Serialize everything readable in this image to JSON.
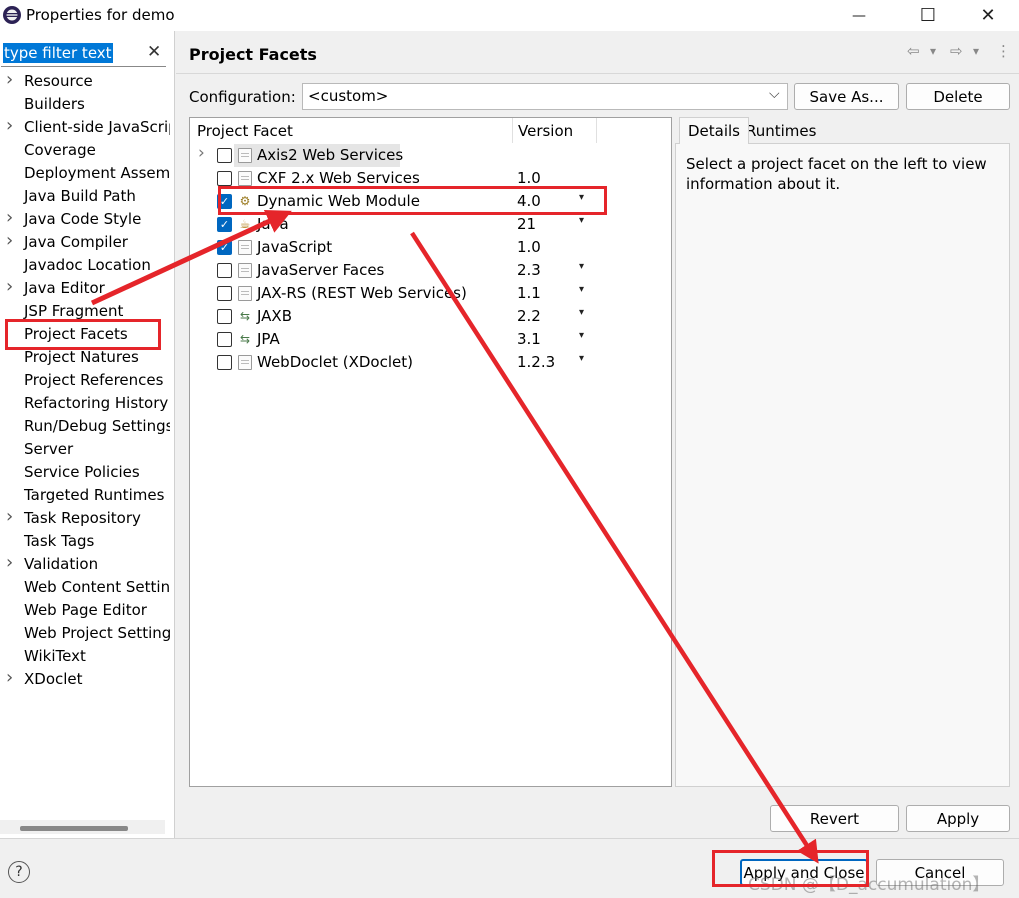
{
  "window": {
    "title": "Properties for demo",
    "minimize_glyph": "—",
    "maximize_glyph": "☐",
    "close_glyph": "✕"
  },
  "filter": {
    "placeholder": "type filter text",
    "clear_glyph": "✕"
  },
  "nav": {
    "items": [
      {
        "label": "Resource",
        "expandable": true
      },
      {
        "label": "Builders",
        "expandable": false
      },
      {
        "label": "Client-side JavaScript",
        "expandable": true
      },
      {
        "label": "Coverage",
        "expandable": false
      },
      {
        "label": "Deployment Assembly",
        "expandable": false
      },
      {
        "label": "Java Build Path",
        "expandable": false
      },
      {
        "label": "Java Code Style",
        "expandable": true
      },
      {
        "label": "Java Compiler",
        "expandable": true
      },
      {
        "label": "Javadoc Location",
        "expandable": false
      },
      {
        "label": "Java Editor",
        "expandable": true
      },
      {
        "label": "JSP Fragment",
        "expandable": false
      },
      {
        "label": "Project Facets",
        "expandable": false,
        "selected": true
      },
      {
        "label": "Project Natures",
        "expandable": false
      },
      {
        "label": "Project References",
        "expandable": false
      },
      {
        "label": "Refactoring History",
        "expandable": false
      },
      {
        "label": "Run/Debug Settings",
        "expandable": false
      },
      {
        "label": "Server",
        "expandable": false
      },
      {
        "label": "Service Policies",
        "expandable": false
      },
      {
        "label": "Targeted Runtimes",
        "expandable": false
      },
      {
        "label": "Task Repository",
        "expandable": true
      },
      {
        "label": "Task Tags",
        "expandable": false
      },
      {
        "label": "Validation",
        "expandable": true
      },
      {
        "label": "Web Content Settings",
        "expandable": false
      },
      {
        "label": "Web Page Editor",
        "expandable": false
      },
      {
        "label": "Web Project Settings",
        "expandable": false
      },
      {
        "label": "WikiText",
        "expandable": false
      },
      {
        "label": "XDoclet",
        "expandable": true
      }
    ]
  },
  "page": {
    "title": "Project Facets",
    "nav_back_glyph": "⇦",
    "nav_forward_glyph": "⇨",
    "nav_menu_glyph": "▾",
    "more_glyph": "⋮"
  },
  "config": {
    "label": "Configuration:",
    "value": "<custom>",
    "save_as_label": "Save As...",
    "delete_label": "Delete"
  },
  "facets": {
    "col_facet": "Project Facet",
    "col_version": "Version",
    "rows": [
      {
        "name": "Axis2 Web Services",
        "version": "",
        "checked": false,
        "expandable": true,
        "icon": "doc",
        "dropdown": false,
        "selected": true
      },
      {
        "name": "CXF 2.x Web Services",
        "version": "1.0",
        "checked": false,
        "icon": "doc",
        "dropdown": false
      },
      {
        "name": "Dynamic Web Module",
        "version": "4.0",
        "checked": true,
        "icon": "web-module",
        "dropdown": true
      },
      {
        "name": "Java",
        "version": "21",
        "checked": true,
        "icon": "java",
        "dropdown": true
      },
      {
        "name": "JavaScript",
        "version": "1.0",
        "checked": true,
        "icon": "doc",
        "dropdown": false
      },
      {
        "name": "JavaServer Faces",
        "version": "2.3",
        "checked": false,
        "icon": "doc",
        "dropdown": true
      },
      {
        "name": "JAX-RS (REST Web Services)",
        "version": "1.1",
        "checked": false,
        "icon": "doc",
        "dropdown": true
      },
      {
        "name": "JAXB",
        "version": "2.2",
        "checked": false,
        "icon": "arrows",
        "dropdown": true
      },
      {
        "name": "JPA",
        "version": "3.1",
        "checked": false,
        "icon": "arrows",
        "dropdown": true
      },
      {
        "name": "WebDoclet (XDoclet)",
        "version": "1.2.3",
        "checked": false,
        "icon": "doc",
        "dropdown": true
      }
    ]
  },
  "details": {
    "tab_details": "Details",
    "tab_runtimes": "Runtimes",
    "text": "Select a project facet on the left to view information about it."
  },
  "buttons": {
    "revert": "Revert",
    "apply": "Apply",
    "apply_close": "Apply and Close",
    "cancel": "Cancel",
    "help_glyph": "?"
  },
  "watermark": "CSDN @【D_accumulation】",
  "colors": {
    "accent": "#0067c0",
    "annotation_red": "#e5252a"
  }
}
